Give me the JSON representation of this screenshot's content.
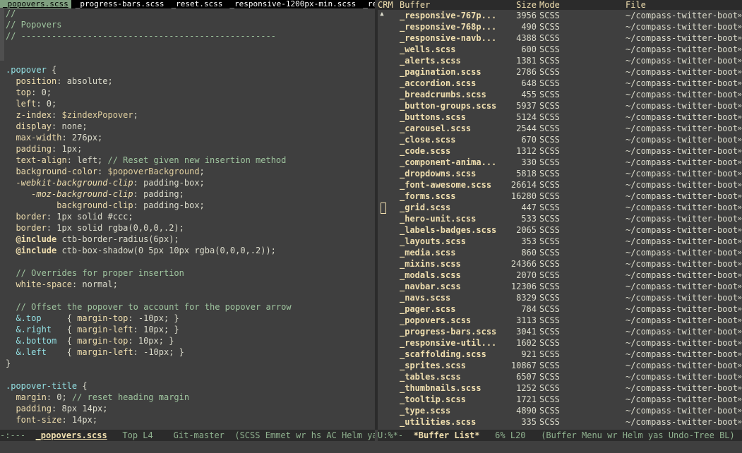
{
  "tabs": [
    "_popovers.scss",
    "_progress-bars.scss",
    "_reset.scss",
    "_responsive-1200px-min.scss",
    "_responsive-7"
  ],
  "editor_lines": [
    [
      [
        "c-comment",
        "//"
      ]
    ],
    [
      [
        "c-comment",
        "// Popovers"
      ]
    ],
    [
      [
        "c-comment",
        "// --------------------------------------------------"
      ]
    ],
    [],
    [],
    [
      [
        "c-sel",
        ".popover"
      ],
      [
        "c-val",
        " {"
      ]
    ],
    [
      [
        "c-val",
        "  "
      ],
      [
        "c-prop",
        "position"
      ],
      [
        "c-val",
        ": absolute;"
      ]
    ],
    [
      [
        "c-val",
        "  "
      ],
      [
        "c-prop",
        "top"
      ],
      [
        "c-val",
        ": 0;"
      ]
    ],
    [
      [
        "c-val",
        "  "
      ],
      [
        "c-prop",
        "left"
      ],
      [
        "c-val",
        ": 0;"
      ]
    ],
    [
      [
        "c-val",
        "  "
      ],
      [
        "c-prop",
        "z-index"
      ],
      [
        "c-val",
        ": "
      ],
      [
        "c-var",
        "$zindexPopover"
      ],
      [
        "c-val",
        ";"
      ]
    ],
    [
      [
        "c-val",
        "  "
      ],
      [
        "c-prop",
        "display"
      ],
      [
        "c-val",
        ": none;"
      ]
    ],
    [
      [
        "c-val",
        "  "
      ],
      [
        "c-prop",
        "max-width"
      ],
      [
        "c-val",
        ": 276px;"
      ]
    ],
    [
      [
        "c-val",
        "  "
      ],
      [
        "c-prop",
        "padding"
      ],
      [
        "c-val",
        ": 1px;"
      ]
    ],
    [
      [
        "c-val",
        "  "
      ],
      [
        "c-prop",
        "text-align"
      ],
      [
        "c-val",
        ": left; "
      ],
      [
        "c-comment",
        "// Reset given new insertion method"
      ]
    ],
    [
      [
        "c-val",
        "  "
      ],
      [
        "c-prop",
        "background-color"
      ],
      [
        "c-val",
        ": "
      ],
      [
        "c-var",
        "$popoverBackground"
      ],
      [
        "c-val",
        ";"
      ]
    ],
    [
      [
        "c-val",
        "  "
      ],
      [
        "c-vendor",
        "-webkit-background-clip"
      ],
      [
        "c-val",
        ": padding-box;"
      ]
    ],
    [
      [
        "c-val",
        "     "
      ],
      [
        "c-vendor",
        "-moz-background-clip"
      ],
      [
        "c-val",
        ": padding;"
      ]
    ],
    [
      [
        "c-val",
        "          "
      ],
      [
        "c-prop",
        "background-clip"
      ],
      [
        "c-val",
        ": padding-box;"
      ]
    ],
    [
      [
        "c-val",
        "  "
      ],
      [
        "c-prop",
        "border"
      ],
      [
        "c-val",
        ": 1px solid #ccc;"
      ]
    ],
    [
      [
        "c-val",
        "  "
      ],
      [
        "c-prop",
        "border"
      ],
      [
        "c-val",
        ": 1px solid rgba(0,0,0,.2);"
      ]
    ],
    [
      [
        "c-val",
        "  "
      ],
      [
        "c-at",
        "@include"
      ],
      [
        "c-val",
        " ctb-border-radius(6px);"
      ]
    ],
    [
      [
        "c-val",
        "  "
      ],
      [
        "c-at",
        "@include"
      ],
      [
        "c-val",
        " ctb-box-shadow(0 5px 10px rgba(0,0,0,.2));"
      ]
    ],
    [],
    [
      [
        "c-val",
        "  "
      ],
      [
        "c-comment",
        "// Overrides for proper insertion"
      ]
    ],
    [
      [
        "c-val",
        "  "
      ],
      [
        "c-prop",
        "white-space"
      ],
      [
        "c-val",
        ": normal;"
      ]
    ],
    [],
    [
      [
        "c-val",
        "  "
      ],
      [
        "c-comment",
        "// Offset the popover to account for the popover arrow"
      ]
    ],
    [
      [
        "c-val",
        "  "
      ],
      [
        "c-sel",
        "&.top"
      ],
      [
        "c-val",
        "     { "
      ],
      [
        "c-prop",
        "margin-top"
      ],
      [
        "c-val",
        ": -10px; }"
      ]
    ],
    [
      [
        "c-val",
        "  "
      ],
      [
        "c-sel",
        "&.right"
      ],
      [
        "c-val",
        "   { "
      ],
      [
        "c-prop",
        "margin-left"
      ],
      [
        "c-val",
        ": 10px; }"
      ]
    ],
    [
      [
        "c-val",
        "  "
      ],
      [
        "c-sel",
        "&.bottom"
      ],
      [
        "c-val",
        "  { "
      ],
      [
        "c-prop",
        "margin-top"
      ],
      [
        "c-val",
        ": 10px; }"
      ]
    ],
    [
      [
        "c-val",
        "  "
      ],
      [
        "c-sel",
        "&.left"
      ],
      [
        "c-val",
        "    { "
      ],
      [
        "c-prop",
        "margin-left"
      ],
      [
        "c-val",
        ": -10px; }"
      ]
    ],
    [
      [
        "c-val",
        "}"
      ]
    ],
    [],
    [
      [
        "c-sel",
        ".popover-title"
      ],
      [
        "c-val",
        " {"
      ]
    ],
    [
      [
        "c-val",
        "  "
      ],
      [
        "c-prop",
        "margin"
      ],
      [
        "c-val",
        ": 0; "
      ],
      [
        "c-comment",
        "// reset heading margin"
      ]
    ],
    [
      [
        "c-val",
        "  "
      ],
      [
        "c-prop",
        "padding"
      ],
      [
        "c-val",
        ": 8px 14px;"
      ]
    ],
    [
      [
        "c-val",
        "  "
      ],
      [
        "c-prop",
        "font-size"
      ],
      [
        "c-val",
        ": 14px;"
      ]
    ]
  ],
  "mode_line_left": {
    "status": "-:---  ",
    "buffer": "_popovers.scss",
    "position": "   Top L4    ",
    "vc": "Git-master  ",
    "modes": "(SCSS Emmet wr hs AC Helm yas"
  },
  "mode_line_right": {
    "status": "U:%*-  ",
    "buffer": "*Buffer List*",
    "position": "   6% L20   ",
    "modes": "(Buffer Menu wr Helm yas Undo-Tree BL)"
  },
  "buffer_list": {
    "header": {
      "crm": "CRM",
      "buffer": "Buffer",
      "size": "Size",
      "mode": "Mode",
      "file": "File"
    },
    "rows": [
      {
        "name": "_responsive-767p...",
        "size": "3956",
        "mode": "SCSS",
        "file": "~/compass-twitter-boots"
      },
      {
        "name": "_responsive-768p...",
        "size": "490",
        "mode": "SCSS",
        "file": "~/compass-twitter-boots"
      },
      {
        "name": "_responsive-navb...",
        "size": "4388",
        "mode": "SCSS",
        "file": "~/compass-twitter-boots"
      },
      {
        "name": "_wells.scss",
        "size": "600",
        "mode": "SCSS",
        "file": "~/compass-twitter-boots"
      },
      {
        "name": "_alerts.scss",
        "size": "1381",
        "mode": "SCSS",
        "file": "~/compass-twitter-boots"
      },
      {
        "name": "_pagination.scss",
        "size": "2786",
        "mode": "SCSS",
        "file": "~/compass-twitter-boots"
      },
      {
        "name": "_accordion.scss",
        "size": "648",
        "mode": "SCSS",
        "file": "~/compass-twitter-boots"
      },
      {
        "name": "_breadcrumbs.scss",
        "size": "455",
        "mode": "SCSS",
        "file": "~/compass-twitter-boots"
      },
      {
        "name": "_button-groups.scss",
        "size": "5937",
        "mode": "SCSS",
        "file": "~/compass-twitter-boots"
      },
      {
        "name": "_buttons.scss",
        "size": "5124",
        "mode": "SCSS",
        "file": "~/compass-twitter-boots"
      },
      {
        "name": "_carousel.scss",
        "size": "2544",
        "mode": "SCSS",
        "file": "~/compass-twitter-boots"
      },
      {
        "name": "_close.scss",
        "size": "670",
        "mode": "SCSS",
        "file": "~/compass-twitter-boots"
      },
      {
        "name": "_code.scss",
        "size": "1312",
        "mode": "SCSS",
        "file": "~/compass-twitter-boots"
      },
      {
        "name": "_component-anima...",
        "size": "330",
        "mode": "SCSS",
        "file": "~/compass-twitter-boots"
      },
      {
        "name": "_dropdowns.scss",
        "size": "5818",
        "mode": "SCSS",
        "file": "~/compass-twitter-boots"
      },
      {
        "name": "_font-awesome.scss",
        "size": "26614",
        "mode": "SCSS",
        "file": "~/compass-twitter-boots"
      },
      {
        "name": "_forms.scss",
        "size": "16280",
        "mode": "SCSS",
        "file": "~/compass-twitter-boots"
      },
      {
        "name": "_grid.scss",
        "size": "447",
        "mode": "SCSS",
        "file": "~/compass-twitter-boots"
      },
      {
        "name": "_hero-unit.scss",
        "size": "533",
        "mode": "SCSS",
        "file": "~/compass-twitter-boots"
      },
      {
        "name": "_labels-badges.scss",
        "size": "2065",
        "mode": "SCSS",
        "file": "~/compass-twitter-boots"
      },
      {
        "name": "_layouts.scss",
        "size": "353",
        "mode": "SCSS",
        "file": "~/compass-twitter-boots"
      },
      {
        "name": "_media.scss",
        "size": "860",
        "mode": "SCSS",
        "file": "~/compass-twitter-boots"
      },
      {
        "name": "_mixins.scss",
        "size": "24366",
        "mode": "SCSS",
        "file": "~/compass-twitter-boots"
      },
      {
        "name": "_modals.scss",
        "size": "2070",
        "mode": "SCSS",
        "file": "~/compass-twitter-boots"
      },
      {
        "name": "_navbar.scss",
        "size": "12306",
        "mode": "SCSS",
        "file": "~/compass-twitter-boots"
      },
      {
        "name": "_navs.scss",
        "size": "8329",
        "mode": "SCSS",
        "file": "~/compass-twitter-boots"
      },
      {
        "name": "_pager.scss",
        "size": "784",
        "mode": "SCSS",
        "file": "~/compass-twitter-boots"
      },
      {
        "name": "_popovers.scss",
        "size": "3113",
        "mode": "SCSS",
        "file": "~/compass-twitter-boots"
      },
      {
        "name": "_progress-bars.scss",
        "size": "3041",
        "mode": "SCSS",
        "file": "~/compass-twitter-boots"
      },
      {
        "name": "_responsive-util...",
        "size": "1602",
        "mode": "SCSS",
        "file": "~/compass-twitter-boots"
      },
      {
        "name": "_scaffolding.scss",
        "size": "921",
        "mode": "SCSS",
        "file": "~/compass-twitter-boots"
      },
      {
        "name": "_sprites.scss",
        "size": "10867",
        "mode": "SCSS",
        "file": "~/compass-twitter-boots"
      },
      {
        "name": "_tables.scss",
        "size": "6507",
        "mode": "SCSS",
        "file": "~/compass-twitter-boots"
      },
      {
        "name": "_thumbnails.scss",
        "size": "1252",
        "mode": "SCSS",
        "file": "~/compass-twitter-boots"
      },
      {
        "name": "_tooltip.scss",
        "size": "1721",
        "mode": "SCSS",
        "file": "~/compass-twitter-boots"
      },
      {
        "name": "_type.scss",
        "size": "4890",
        "mode": "SCSS",
        "file": "~/compass-twitter-boots"
      },
      {
        "name": "_utilities.scss",
        "size": "335",
        "mode": "SCSS",
        "file": "~/compass-twitter-boots"
      }
    ],
    "truncation_glyph": "»",
    "scroll_up_glyph": "▲"
  }
}
